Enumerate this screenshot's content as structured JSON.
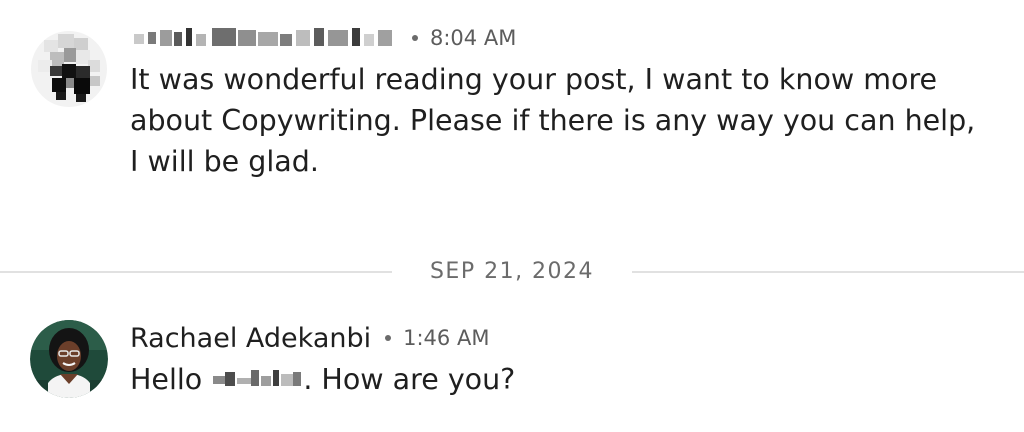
{
  "conversation": {
    "messages": [
      {
        "sender": "",
        "timestamp": "8:04 AM",
        "body": "It was wonderful reading your post, I want to know more about Copywriting. Please if there is any way you can help, I will be glad."
      },
      {
        "sender": "Rachael Adekanbi",
        "timestamp": "1:46 AM",
        "body_before": "Hello ",
        "body_after": ". How are you?"
      }
    ],
    "date_divider": "SEP 21, 2024"
  },
  "colors": {
    "text": "#1f1f1f",
    "secondary_text": "#5c5c5c",
    "divider": "#e1e1e1",
    "avatar_ring": "#1f4a3a"
  },
  "icons": {
    "message_1_avatar": "pixelated-avatar",
    "message_2_avatar": "profile-photo-avatar"
  }
}
